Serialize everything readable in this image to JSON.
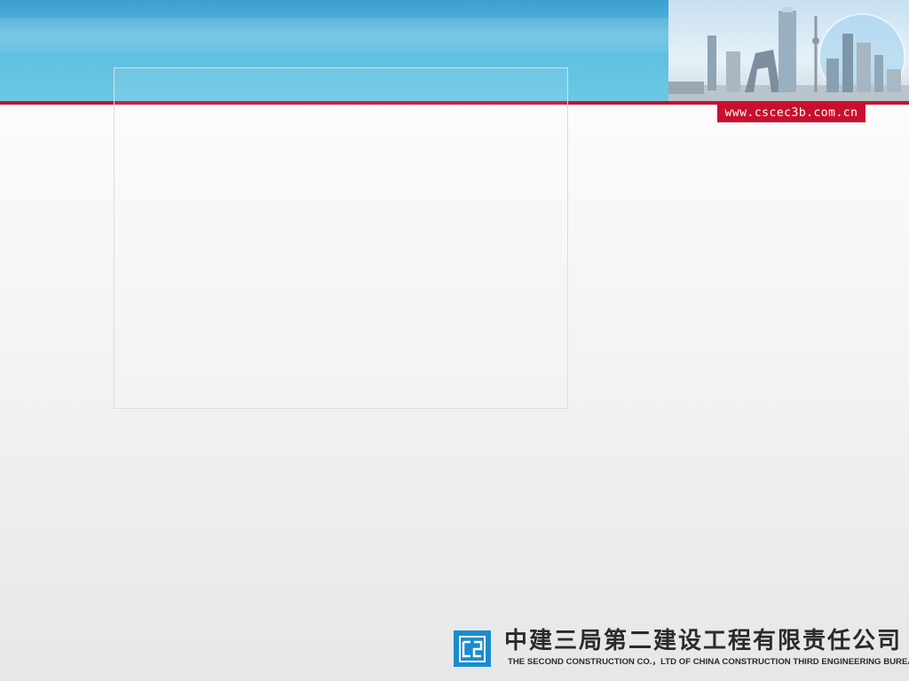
{
  "header": {
    "url": "www.cscec3b.com.cn",
    "skyline_icon": "city-skyline-icon",
    "accent_color": "#c8102e",
    "band_color": "#5bbbe0"
  },
  "footer": {
    "logo_icon": "cscec-logo-icon",
    "company_cn": "中建三局第二建设工程有限责任公司",
    "company_en": "THE SECOND CONSTRUCTION CO.，LTD OF CHINA CONSTRUCTION THIRD ENGINEERING BUREAU",
    "logo_color": "#1a8ccd"
  }
}
